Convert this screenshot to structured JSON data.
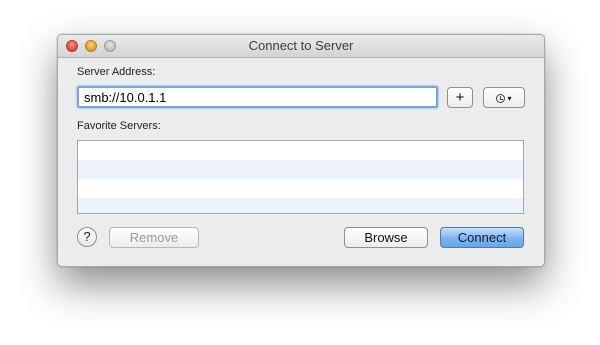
{
  "window": {
    "title": "Connect to Server"
  },
  "server_address": {
    "label": "Server Address:",
    "value": "smb://10.0.1.1"
  },
  "buttons": {
    "add": "+",
    "recent_icon": "clock-icon",
    "recent_arrow": "▾",
    "help": "?",
    "remove": "Remove",
    "browse": "Browse",
    "connect": "Connect"
  },
  "favorites": {
    "label": "Favorite Servers:",
    "items": []
  },
  "colors": {
    "accent": "#6aa5ea",
    "focus_ring": "#75a7e6"
  }
}
